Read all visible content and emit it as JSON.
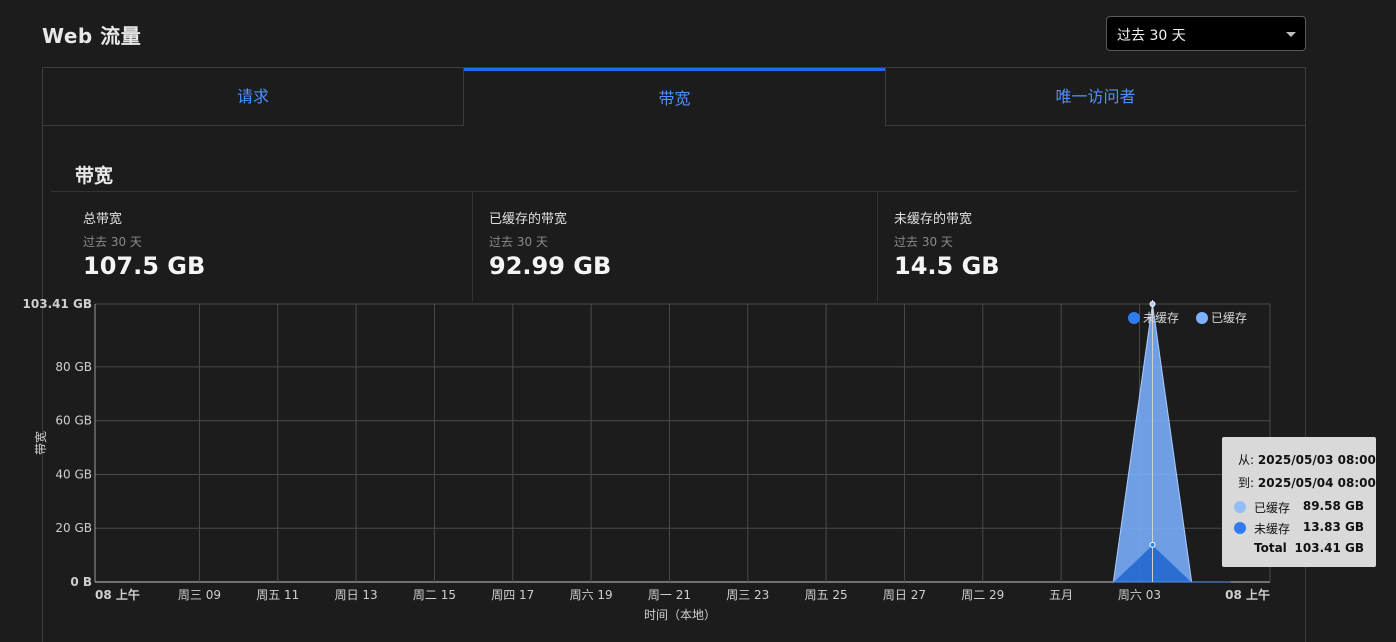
{
  "header": {
    "title": "Web 流量"
  },
  "range_select": {
    "value": "过去 30 天"
  },
  "tabs": [
    {
      "label": "请求"
    },
    {
      "label": "带宽"
    },
    {
      "label": "唯一访问者"
    }
  ],
  "section": {
    "title": "带宽"
  },
  "stats": [
    {
      "label": "总带宽",
      "period": "过去 30 天",
      "value": "107.5 GB"
    },
    {
      "label": "已缓存的带宽",
      "period": "过去 30 天",
      "value": "92.99 GB"
    },
    {
      "label": "未缓存的带宽",
      "period": "过去 30 天",
      "value": "14.5 GB"
    }
  ],
  "colors": {
    "cached": "#7cb1ff",
    "uncached": "#2f7bf0",
    "accent": "#1d6cf0",
    "link": "#4f8fff"
  },
  "tooltip": {
    "from_label": "从:",
    "from_value": "2025/05/03 08:00",
    "to_label": "到:",
    "to_value": "2025/05/04 08:00",
    "rows": [
      {
        "label": "已缓存",
        "value": "89.58 GB"
      },
      {
        "label": "未缓存",
        "value": "13.83 GB"
      },
      {
        "label": "Total",
        "value": "103.41 GB"
      }
    ]
  },
  "chart_data": {
    "type": "area",
    "title": "",
    "xlabel": "时间（本地）",
    "ylabel": "带宽",
    "y_unit": "GB",
    "ylim": [
      0,
      103.41
    ],
    "yticks": [
      {
        "value": 0,
        "label": "0 B"
      },
      {
        "value": 20,
        "label": "20 GB"
      },
      {
        "value": 40,
        "label": "40 GB"
      },
      {
        "value": 60,
        "label": "60 GB"
      },
      {
        "value": 80,
        "label": "80 GB"
      },
      {
        "value": 103.41,
        "label": "103.41 GB"
      }
    ],
    "xlim": [
      "2025-04-06 08:00",
      "2025-05-06 08:00"
    ],
    "xticks": [
      {
        "x": "2025-04-06 08:00",
        "label": "08 上午",
        "bold": true
      },
      {
        "x": "2025-04-09",
        "label": "周三 09"
      },
      {
        "x": "2025-04-11",
        "label": "周五 11"
      },
      {
        "x": "2025-04-13",
        "label": "周日 13"
      },
      {
        "x": "2025-04-15",
        "label": "周二 15"
      },
      {
        "x": "2025-04-17",
        "label": "周四 17"
      },
      {
        "x": "2025-04-19",
        "label": "周六 19"
      },
      {
        "x": "2025-04-21",
        "label": "周一 21"
      },
      {
        "x": "2025-04-23",
        "label": "周三 23"
      },
      {
        "x": "2025-04-25",
        "label": "周五 25"
      },
      {
        "x": "2025-04-27",
        "label": "周日 27"
      },
      {
        "x": "2025-04-29",
        "label": "周二 29"
      },
      {
        "x": "2025-05-01",
        "label": "五月"
      },
      {
        "x": "2025-05-03",
        "label": "周六 03"
      },
      {
        "x": "2025-05-06 08:00",
        "label": "08 上午",
        "bold": true
      }
    ],
    "x": [
      "2025-05-02 08:00",
      "2025-05-03 08:00",
      "2025-05-04 08:00",
      "2025-05-05 08:00"
    ],
    "series": [
      {
        "name": "已缓存",
        "values": [
          0,
          89.58,
          0,
          0
        ]
      },
      {
        "name": "未缓存",
        "values": [
          0,
          13.83,
          0,
          0
        ]
      }
    ],
    "legend_position": "top-right",
    "grid": true
  }
}
